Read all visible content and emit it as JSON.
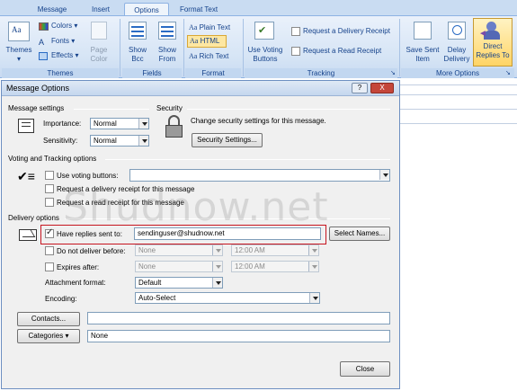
{
  "tabs": [
    "Message",
    "Insert",
    "Options",
    "Format Text"
  ],
  "ribbon": {
    "themes_label": "Themes",
    "colors_label": "Colors",
    "fonts_label": "Fonts",
    "effects_label": "Effects",
    "page_color_label": "Page Color",
    "themes_group": "Themes",
    "show_bcc": "Show Bcc",
    "show_from": "Show From",
    "fields_group": "Fields",
    "plain_text": "Plain Text",
    "html": "HTML",
    "rich_text": "Rich Text",
    "format_group": "Format",
    "use_voting": "Use Voting Buttons",
    "request_delivery": "Request a Delivery Receipt",
    "request_read": "Request a Read Receipt",
    "tracking_group": "Tracking",
    "save_sent": "Save Sent Item",
    "delay_delivery": "Delay Delivery",
    "direct_replies": "Direct Replies To",
    "more_options_group": "More Options"
  },
  "dialog": {
    "title": "Message Options",
    "help_btn": "?",
    "close_btn": "X",
    "message_settings": "Message settings",
    "importance_label": "Importance:",
    "importance_value": "Normal",
    "sensitivity_label": "Sensitivity:",
    "sensitivity_value": "Normal",
    "security": "Security",
    "security_text": "Change security settings for this message.",
    "security_btn": "Security Settings...",
    "voting_section": "Voting and Tracking options",
    "use_voting_label": "Use voting buttons:",
    "delivery_receipt_label": "Request a delivery receipt for this message",
    "read_receipt_label": "Request a read receipt for this message",
    "delivery_section": "Delivery options",
    "have_replies_label": "Have replies sent to:",
    "have_replies_value": "sendinguser@shudnow.net",
    "select_names_btn": "Select Names...",
    "do_not_deliver_label": "Do not deliver before:",
    "do_not_deliver_date": "None",
    "do_not_deliver_time": "12:00 AM",
    "expires_label": "Expires after:",
    "expires_date": "None",
    "expires_time": "12:00 AM",
    "attachment_format_label": "Attachment format:",
    "attachment_format_value": "Default",
    "encoding_label": "Encoding:",
    "encoding_value": "Auto-Select",
    "contacts_btn": "Contacts...",
    "categories_btn": "Categories",
    "categories_value": "None",
    "close_button": "Close"
  },
  "watermark": "Shudnow.net"
}
